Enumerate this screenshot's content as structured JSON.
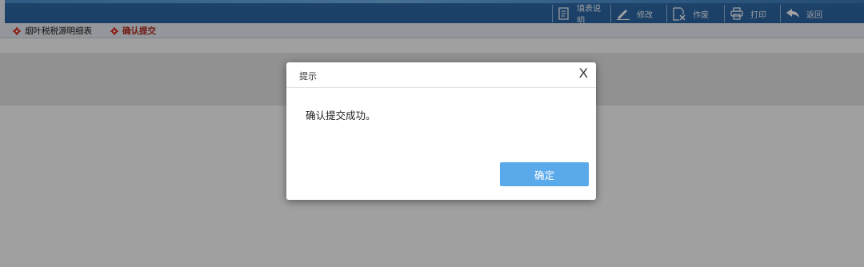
{
  "toolbar": {
    "items": [
      {
        "label": "填表说明",
        "icon": "document-icon"
      },
      {
        "label": "修改",
        "icon": "pencil-icon"
      },
      {
        "label": "作废",
        "icon": "void-document-icon"
      },
      {
        "label": "打印",
        "icon": "printer-icon"
      },
      {
        "label": "返回",
        "icon": "back-arrow-icon"
      }
    ]
  },
  "tabs": [
    {
      "label": "烟叶税税源明细表",
      "active": false
    },
    {
      "label": "确认提交",
      "active": true
    }
  ],
  "dialog": {
    "title": "提示",
    "close_label": "X",
    "message": "确认提交成功。",
    "confirm_label": "确定"
  },
  "colors": {
    "topbar": "#2f6aa8",
    "active_tab": "#b0281c",
    "tab_icon": "#d8322a",
    "confirm_button": "#5aa9ea"
  }
}
